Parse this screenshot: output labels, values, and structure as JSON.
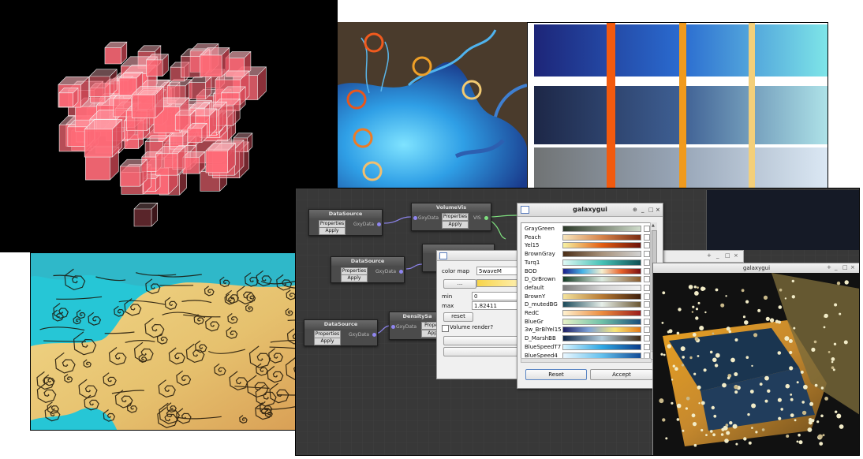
{
  "colors": {
    "background": "#ffffff",
    "editor_bg": "#383838",
    "volume_bg": "#000000",
    "cube_fill": "#ff6b78",
    "port_in": "#8f86f0",
    "port_out": "#7fe07f",
    "overlay_ring_outer": "#f05a1e",
    "overlay_ring_mid": "#f0a027",
    "overlay_ring_inner": "#f2ca72",
    "ocean_cyan": "#26c6d6",
    "land_tan": "#e9c978"
  },
  "node_editor": {
    "nodes": [
      {
        "title": "DataSource",
        "buttons": [
          "Properties",
          "Apply"
        ],
        "outputs": [
          "GxyData"
        ]
      },
      {
        "title": "VolumeVis",
        "buttons": [
          "Properties",
          "Apply"
        ],
        "inputs": [
          "GxyData"
        ],
        "outputs": [
          "VIS"
        ]
      },
      {
        "title": "DataSource",
        "buttons": [
          "Properties",
          "Apply"
        ],
        "outputs": [
          "GxyData"
        ]
      },
      {
        "title": "DataSource",
        "buttons": [
          "Properties",
          "Apply"
        ],
        "outputs": [
          "GxyData"
        ]
      },
      {
        "title": "DensitySa",
        "buttons": [
          "Propert",
          "Appl"
        ],
        "inputs": [
          "GxyData"
        ]
      }
    ]
  },
  "properties_dialog": {
    "color_map_label": "color map",
    "color_map_value": "5waveM",
    "browse_button": "...",
    "min_label": "min",
    "min_value": "0",
    "max_label": "max",
    "max_value": "1.82411",
    "reset_button": "reset",
    "volume_render_label": "Volume render?"
  },
  "colormap_dialog": {
    "title": "galaxygui",
    "colormaps": [
      {
        "name": "GrayGreen",
        "colors": [
          "#2c3a2a",
          "#7f8a78",
          "#cfdccb"
        ]
      },
      {
        "name": "Peach",
        "colors": [
          "#f7e5bb",
          "#d6834a",
          "#7a2d14"
        ]
      },
      {
        "name": "Yel15",
        "colors": [
          "#f7f2a3",
          "#e35d12",
          "#6c1108"
        ]
      },
      {
        "name": "BrownGray",
        "colors": [
          "#4b2e16",
          "#a7917a",
          "#d2d2d2"
        ]
      },
      {
        "name": "Turq1",
        "colors": [
          "#dff9f5",
          "#46c2b6",
          "#0f4f54"
        ]
      },
      {
        "name": "BOD",
        "colors": [
          "#1b1f8a",
          "#46b3e6",
          "#f6f0d0",
          "#e8612a",
          "#7a0d12"
        ]
      },
      {
        "name": "D_GrBrown",
        "colors": [
          "#133b24",
          "#dcece1",
          "#8b5a2b"
        ]
      },
      {
        "name": "default",
        "colors": [
          "#7c7c7c",
          "#d6d6d6",
          "#f0f0f0"
        ]
      },
      {
        "name": "BrownY",
        "colors": [
          "#f4e39d",
          "#b77a34",
          "#3f200d"
        ]
      },
      {
        "name": "D_mutedBG",
        "colors": [
          "#1b4a5a",
          "#e7efe9",
          "#6a5632"
        ]
      },
      {
        "name": "RedC",
        "colors": [
          "#fff1cf",
          "#ec8c3e",
          "#9b1c1c"
        ]
      },
      {
        "name": "BlueGr",
        "colors": [
          "#e7f1c7",
          "#6fc2a8",
          "#1a4c7a"
        ]
      },
      {
        "name": "3w_BrBlYel15",
        "colors": [
          "#1d1e63",
          "#7ea3d8",
          "#f7e77a",
          "#e37a19"
        ]
      },
      {
        "name": "D_MarshBB",
        "colors": [
          "#0e2547",
          "#b5cfdd",
          "#3f2a16"
        ]
      },
      {
        "name": "BlueSpeedT7",
        "colors": [
          "#d8f4ff",
          "#2ea7e4",
          "#0b3c8a"
        ]
      },
      {
        "name": "BlueSpeed4",
        "colors": [
          "#eaf7ff",
          "#64c1ee",
          "#114b96"
        ]
      }
    ],
    "reset_button": "Reset",
    "accept_button": "Accept"
  },
  "render_window": {
    "title": "galaxygui"
  }
}
